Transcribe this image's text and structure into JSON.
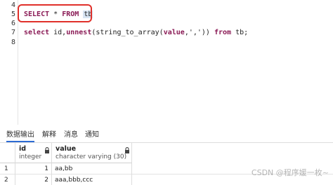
{
  "editor": {
    "line_numbers": [
      "4",
      "5",
      "6",
      "7",
      "8"
    ],
    "line5": {
      "kw1": "SELECT",
      "rest": " * ",
      "kw2": "FROM",
      "ident": "tb"
    },
    "line7": {
      "kw1": "select",
      "part1": " id,",
      "fn1": "unnest",
      "part2": "(string_to_array(",
      "arg": "value",
      "part3": ",','))",
      "kw2": "from",
      "part4": " tb;"
    }
  },
  "results": {
    "tabs": [
      "数据输出",
      "解释",
      "消息",
      "通知"
    ],
    "columns": [
      {
        "name": "id",
        "type": "integer"
      },
      {
        "name": "value",
        "type": "character varying (30)"
      }
    ],
    "rows": [
      {
        "num": "1",
        "id": "1",
        "value": "aa,bb"
      },
      {
        "num": "2",
        "id": "2",
        "value": "aaa,bbb,ccc"
      }
    ]
  },
  "watermark": "CSDN @程序媛一枚~",
  "colors": {
    "keyword": "#8a1a55",
    "highlight_box": "#e0302a",
    "active_tab": "#2d6bd3"
  }
}
